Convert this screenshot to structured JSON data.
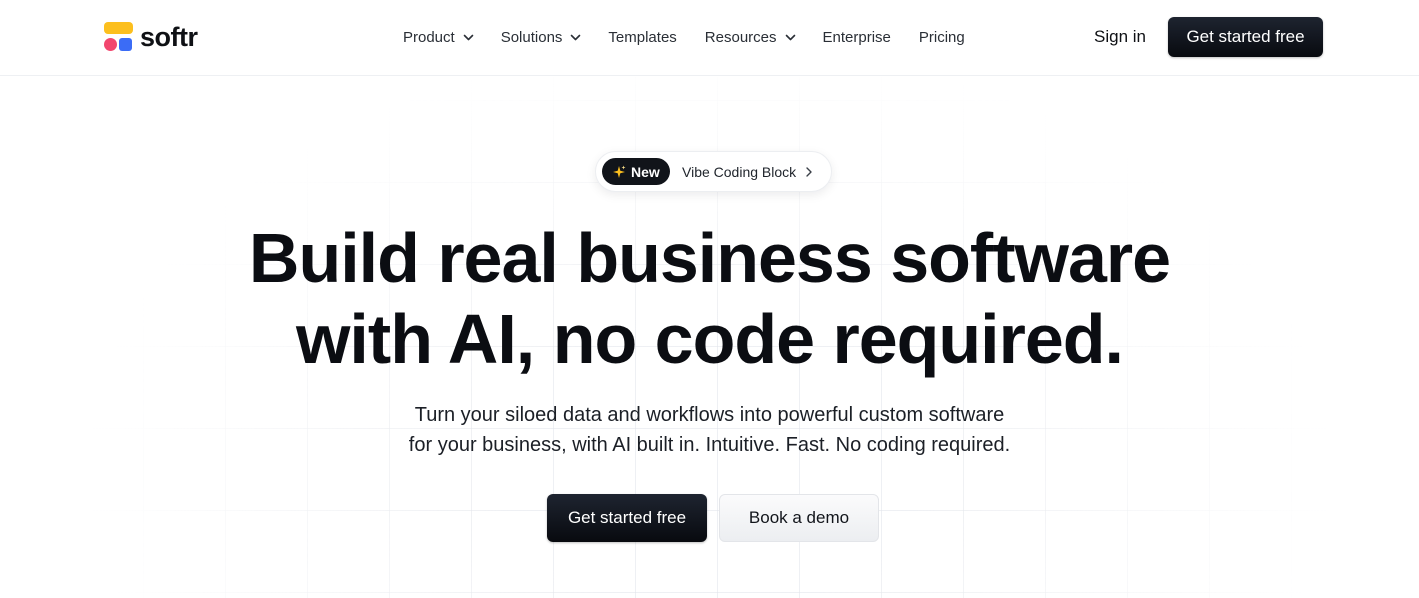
{
  "brand": {
    "name": "softr",
    "colors": {
      "yellow": "#fcbf1e",
      "pink": "#f2466e",
      "blue": "#3b6cf6"
    }
  },
  "nav": {
    "items": [
      {
        "label": "Product",
        "has_dropdown": true
      },
      {
        "label": "Solutions",
        "has_dropdown": true
      },
      {
        "label": "Templates",
        "has_dropdown": false
      },
      {
        "label": "Resources",
        "has_dropdown": true
      },
      {
        "label": "Enterprise",
        "has_dropdown": false
      },
      {
        "label": "Pricing",
        "has_dropdown": false
      }
    ],
    "sign_in": "Sign in",
    "cta": "Get started free"
  },
  "announcement": {
    "badge": "New",
    "badge_icon": "sparkle-icon",
    "text": "Vibe Coding Block",
    "arrow_icon": "chevron-right-icon"
  },
  "hero": {
    "title_line1": "Build real business software",
    "title_line2": "with AI, no code required.",
    "subtitle_line1": "Turn your siloed data and workflows into powerful custom software",
    "subtitle_line2": "for your business, with AI built in. Intuitive. Fast. No coding required.",
    "primary_cta": "Get started free",
    "secondary_cta": "Book a demo"
  },
  "theme": {
    "dark_button": "#0f1115",
    "text": "#0f1115"
  }
}
